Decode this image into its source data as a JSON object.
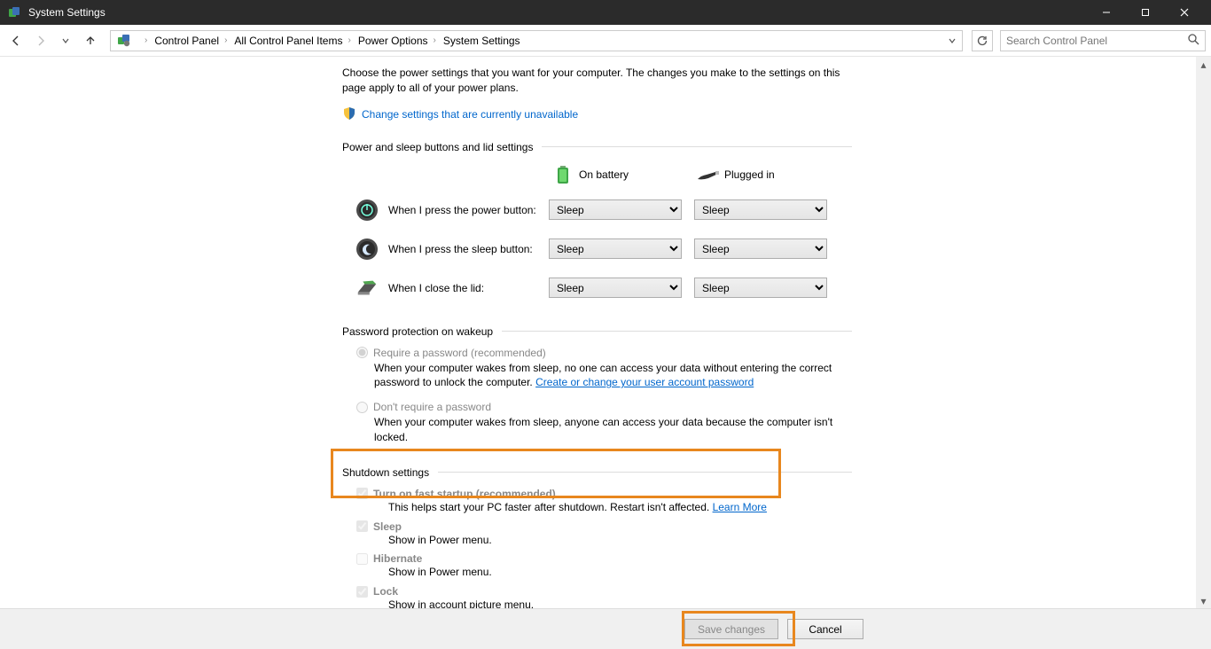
{
  "window": {
    "title": "System Settings"
  },
  "breadcrumb": {
    "items": [
      "Control Panel",
      "All Control Panel Items",
      "Power Options",
      "System Settings"
    ]
  },
  "search": {
    "placeholder": "Search Control Panel"
  },
  "intro": "Choose the power settings that you want for your computer. The changes you make to the settings on this page apply to all of your power plans.",
  "change_link": "Change settings that are currently unavailable",
  "section_buttons": "Power and sleep buttons and lid settings",
  "cols": {
    "battery": "On battery",
    "plugged": "Plugged in"
  },
  "rows": {
    "power": {
      "label": "When I press the power button:",
      "battery": "Sleep",
      "plugged": "Sleep"
    },
    "sleep": {
      "label": "When I press the sleep button:",
      "battery": "Sleep",
      "plugged": "Sleep"
    },
    "lid": {
      "label": "When I close the lid:",
      "battery": "Sleep",
      "plugged": "Sleep"
    }
  },
  "section_password": "Password protection on wakeup",
  "pwd": {
    "require_label": "Require a password (recommended)",
    "require_desc_a": "When your computer wakes from sleep, no one can access your data without entering the correct password to unlock the computer. ",
    "require_link": "Create or change your user account password",
    "dont_label": "Don't require a password",
    "dont_desc": "When your computer wakes from sleep, anyone can access your data because the computer isn't locked."
  },
  "section_shutdown": "Shutdown settings",
  "shutdown": {
    "fast_label": "Turn on fast startup (recommended)",
    "fast_desc": "This helps start your PC faster after shutdown. Restart isn't affected. ",
    "fast_link": "Learn More",
    "sleep_label": "Sleep",
    "sleep_desc": "Show in Power menu.",
    "hib_label": "Hibernate",
    "hib_desc": "Show in Power menu.",
    "lock_label": "Lock",
    "lock_desc": "Show in account picture menu."
  },
  "buttons": {
    "save": "Save changes",
    "cancel": "Cancel"
  }
}
